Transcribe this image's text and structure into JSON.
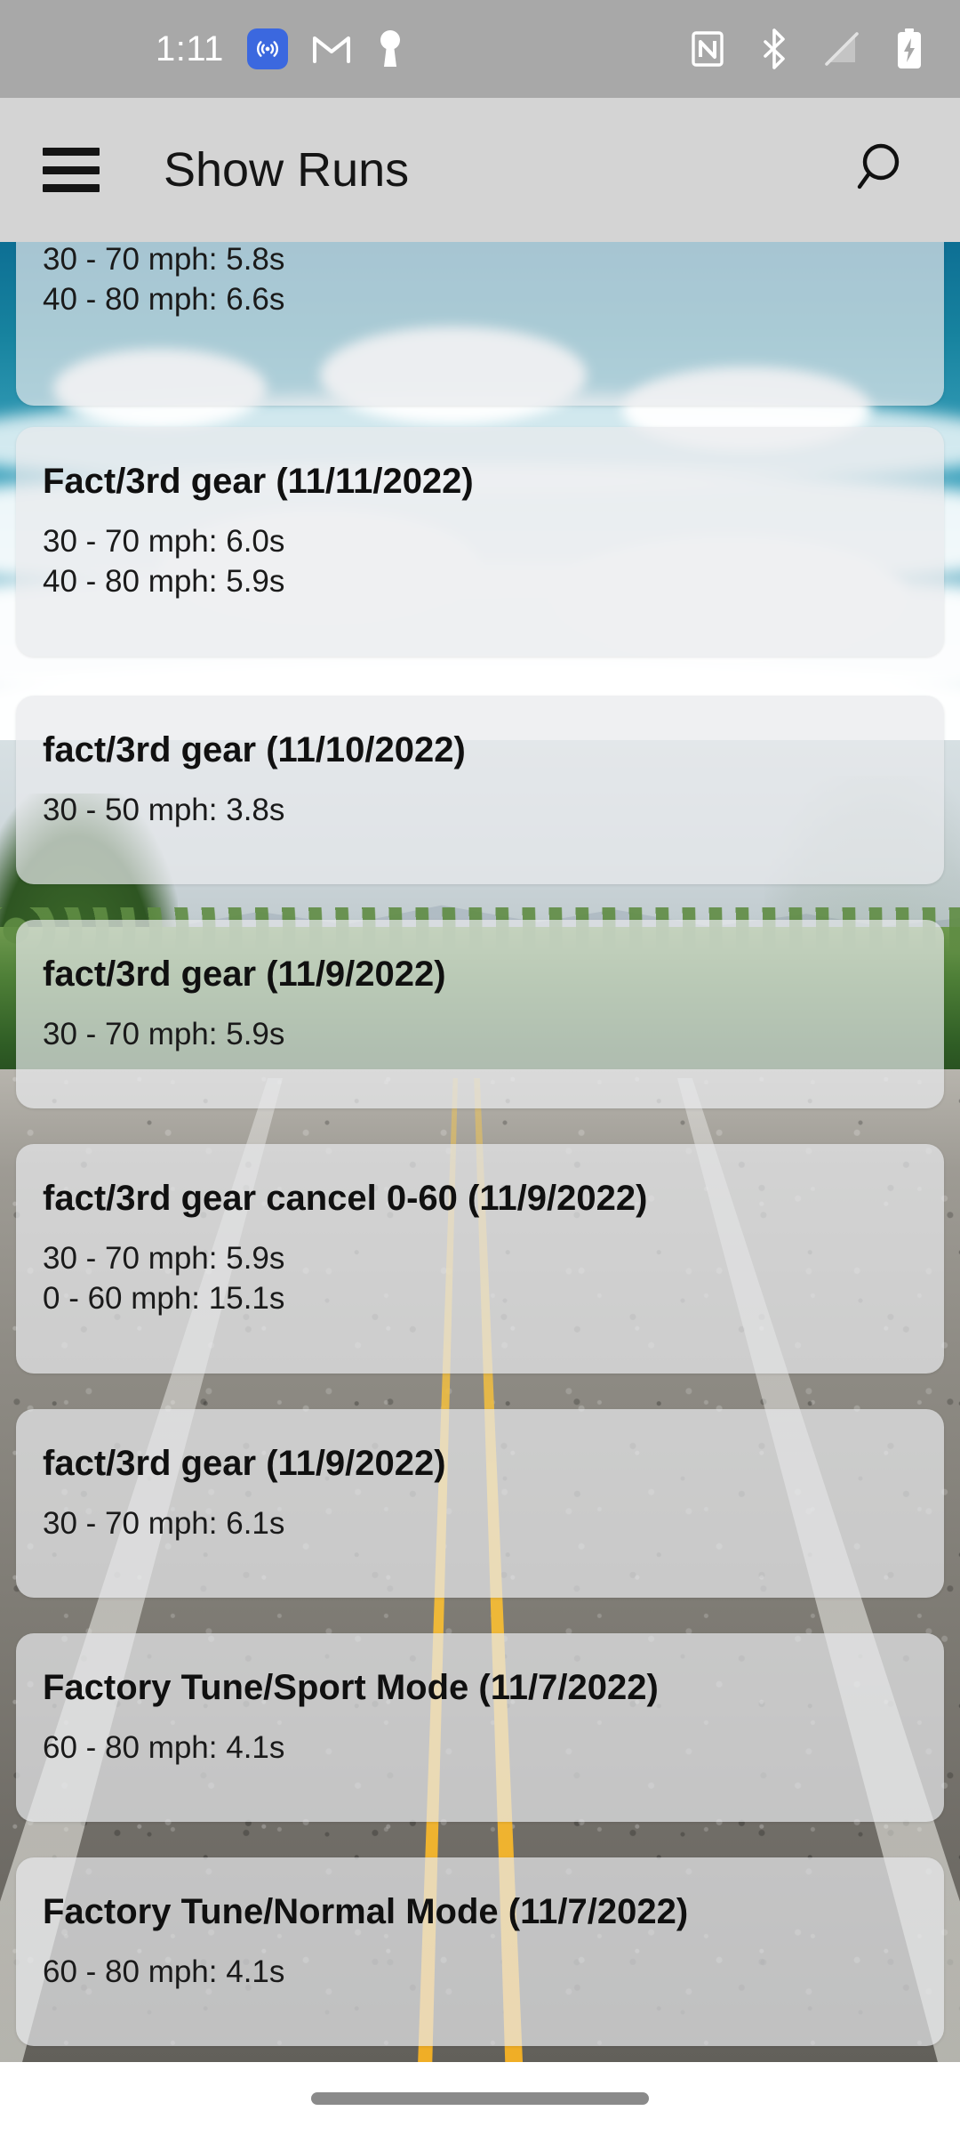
{
  "status_bar": {
    "time": "1:11",
    "left_icons": [
      {
        "name": "cast-icon",
        "label": "cast"
      },
      {
        "name": "gmail-icon",
        "label": "Gmail"
      },
      {
        "name": "keyhole-icon",
        "label": "keyhole"
      }
    ],
    "right_icons": [
      {
        "name": "nfc-icon",
        "label": "NFC"
      },
      {
        "name": "bluetooth-icon",
        "label": "Bluetooth"
      },
      {
        "name": "no-signal-icon",
        "label": "No signal"
      },
      {
        "name": "battery-charging-icon",
        "label": "Battery charging"
      }
    ]
  },
  "app_bar": {
    "menu_icon": "hamburger-menu-icon",
    "title": "Show Runs",
    "search_icon": "search-icon",
    "background_color": "#d4d4d4"
  },
  "runs": [
    {
      "title": "",
      "title_clipped": true,
      "lines": [
        "30 - 70 mph: 5.8s",
        "40 - 80 mph: 6.6s"
      ]
    },
    {
      "title": "Fact/3rd gear (11/11/2022)",
      "lines": [
        "30 - 70 mph: 6.0s",
        "40 - 80 mph: 5.9s"
      ]
    },
    {
      "title": "fact/3rd gear (11/10/2022)",
      "lines": [
        "30 - 50 mph: 3.8s"
      ]
    },
    {
      "title": "fact/3rd gear (11/9/2022)",
      "lines": [
        "30 - 70 mph: 5.9s"
      ]
    },
    {
      "title": "fact/3rd gear cancel 0-60 (11/9/2022)",
      "lines": [
        "30 - 70 mph: 5.9s",
        "0 - 60 mph: 15.1s"
      ]
    },
    {
      "title": "fact/3rd gear (11/9/2022)",
      "lines": [
        "30 - 70 mph: 6.1s"
      ]
    },
    {
      "title": "Factory Tune/Sport Mode (11/7/2022)",
      "lines": [
        "60 - 80 mph: 4.1s"
      ]
    },
    {
      "title": "Factory Tune/Normal Mode (11/7/2022)",
      "lines": [
        "60 - 80 mph: 4.1s"
      ]
    }
  ],
  "navigation_bar": {
    "gesture_pill": "home-gesture-handle"
  },
  "colors": {
    "status_bar_bg": "#a8a8a8",
    "app_bar_bg": "#d4d4d4",
    "card_bg": "rgba(232,234,236,0.70)",
    "text_primary": "#101010",
    "cast_accent": "#3b68df",
    "road_yellow": "#f0ae26"
  }
}
